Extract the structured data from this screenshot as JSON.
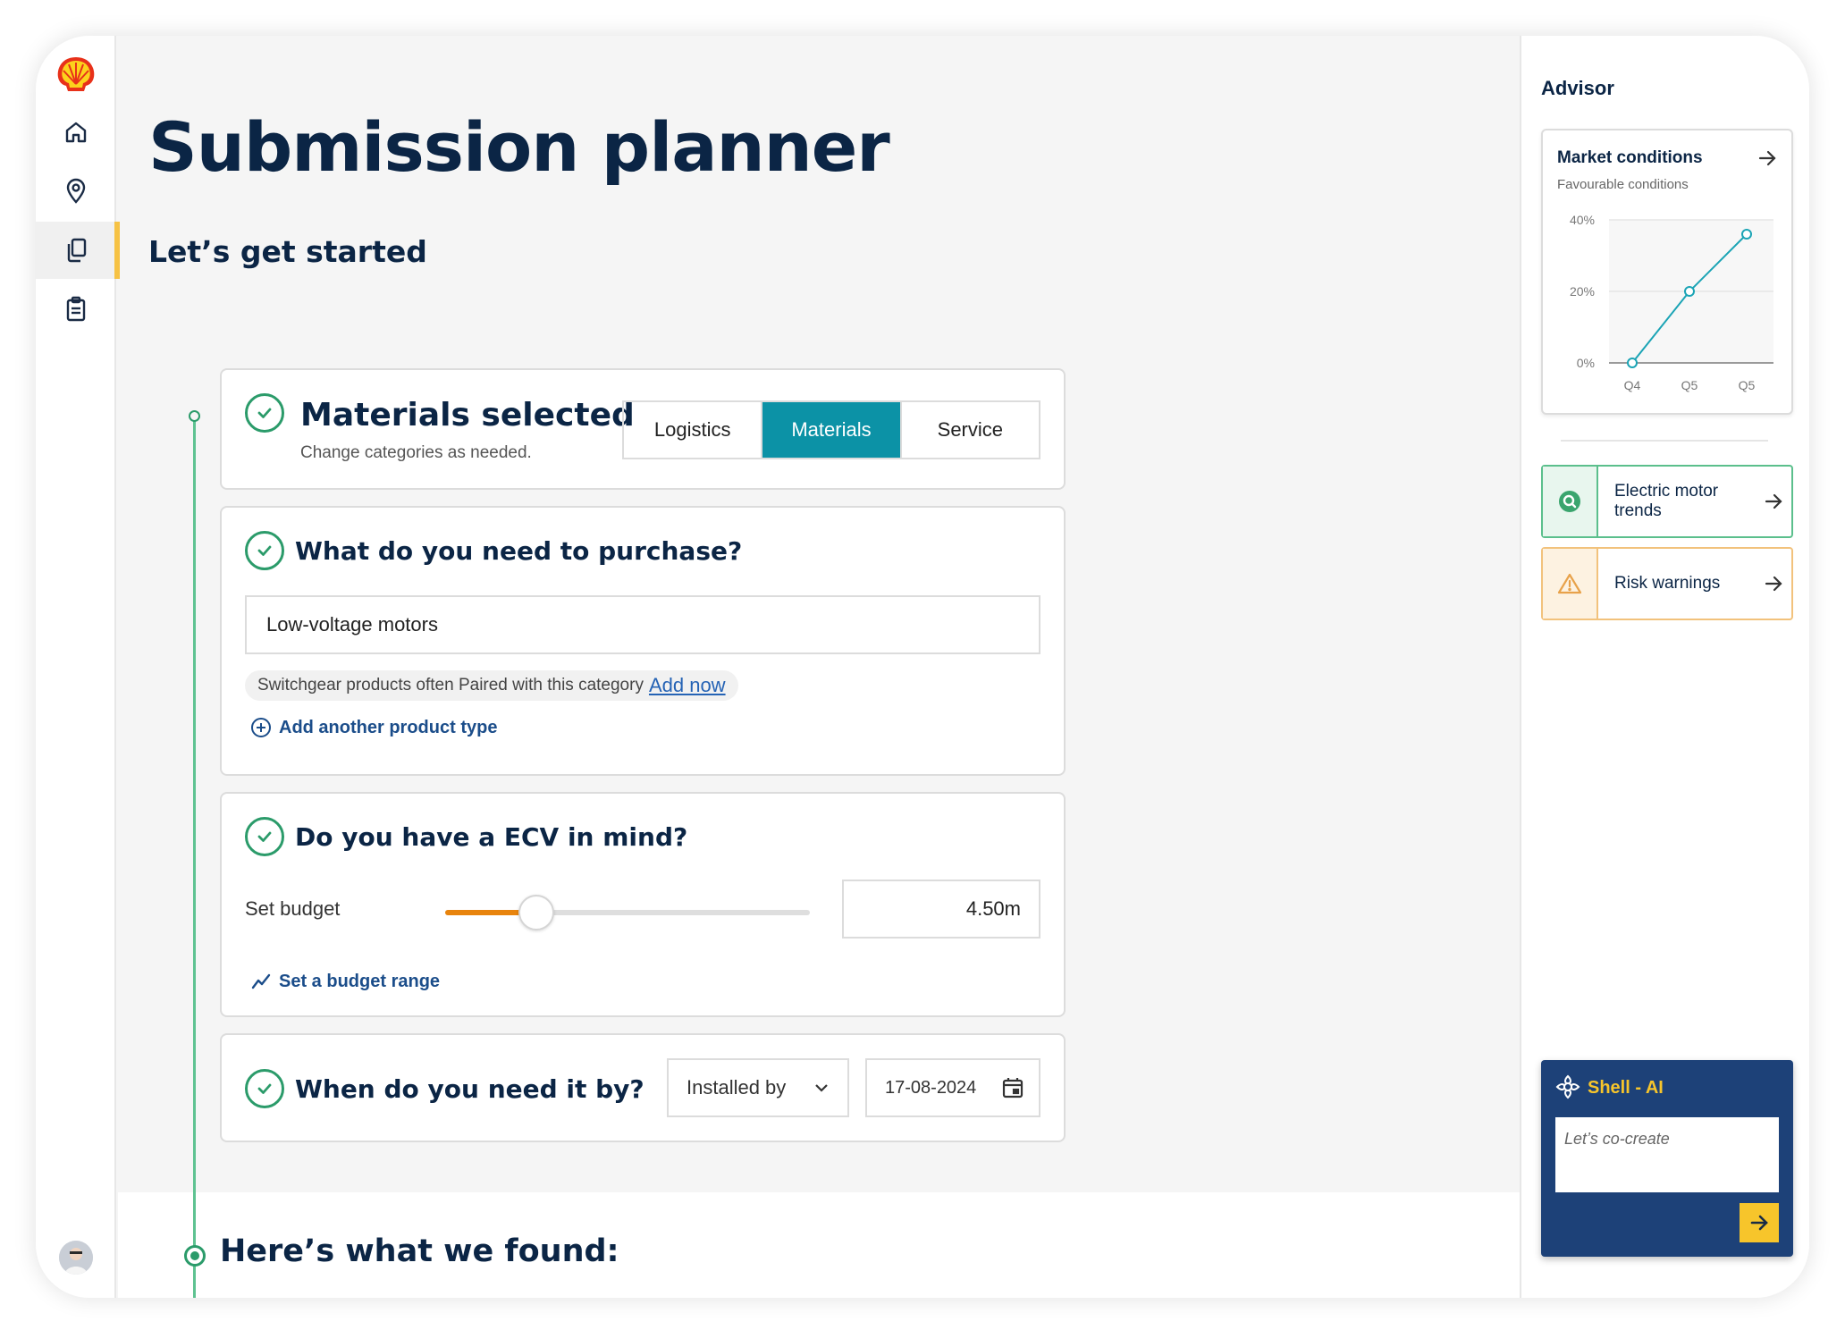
{
  "page": {
    "title": "Submission planner",
    "subtitle": "Let’s get started",
    "found_title": "Here’s what we found:"
  },
  "nav": {
    "items": [
      {
        "icon": "home-icon"
      },
      {
        "icon": "location-pin-icon"
      },
      {
        "icon": "documents-icon",
        "active": true
      },
      {
        "icon": "clipboard-icon"
      }
    ]
  },
  "materials_card": {
    "title": "Materials selected",
    "subtitle": "Change categories as needed.",
    "options": [
      "Logistics",
      "Materials",
      "Service"
    ],
    "selected": "Materials"
  },
  "purchase_card": {
    "title": "What do you need to purchase?",
    "input_value": "Low-voltage motors",
    "hint_text": "Switchgear products often Paired with this category",
    "hint_link": "Add now",
    "add_link": "Add another product type"
  },
  "budget_card": {
    "title": "Do you have a ECV in mind?",
    "label": "Set budget",
    "value": "4.50m",
    "slider_fraction": 0.25,
    "range_link": "Set a budget range"
  },
  "timing_card": {
    "title": "When do you need it by?",
    "select_value": "Installed by",
    "date_value": "17-08-2024"
  },
  "advisor": {
    "title": "Advisor",
    "market": {
      "title": "Market conditions",
      "subtitle": "Favourable conditions"
    },
    "cards": [
      {
        "label": "Electric motor trends",
        "icon": "search-icon",
        "accent": "#5bbf8c",
        "tint": "#e8f6ee"
      },
      {
        "label": "Risk warnings",
        "icon": "warning-icon",
        "accent": "#f2c27c",
        "tint": "#fdf2e1"
      }
    ],
    "ai": {
      "title": "Shell - AI",
      "placeholder": "Let’s co-create"
    }
  },
  "colors": {
    "accent_teal": "#0c92a6",
    "slider_orange": "#e8840d",
    "timeline_green": "#2b9b6a",
    "nav_active": "#f6c244",
    "ai_navy": "#1d4178",
    "ai_yellow": "#f7c52b"
  },
  "chart_data": {
    "type": "line",
    "title": "Market conditions",
    "categories": [
      "Q4",
      "Q5",
      "Q5"
    ],
    "values": [
      0,
      20,
      36
    ],
    "y_ticks": [
      "0%",
      "20%",
      "40%"
    ],
    "ylim": [
      0,
      40
    ],
    "grid": true,
    "line_color": "#1ba4b5"
  }
}
